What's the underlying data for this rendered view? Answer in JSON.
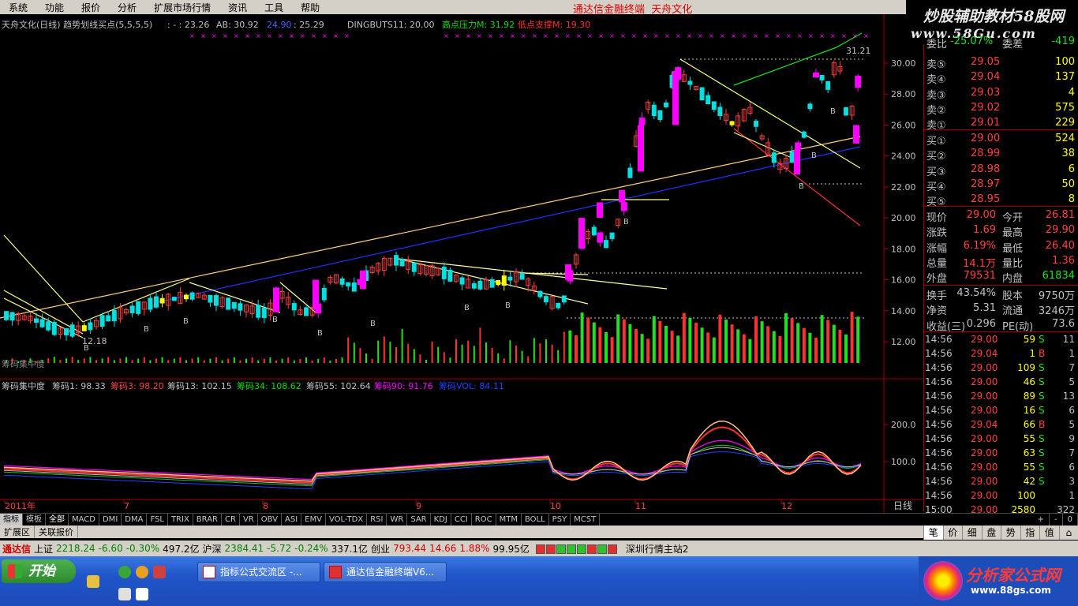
{
  "menu": {
    "items": [
      "系统",
      "功能",
      "报价",
      "分析",
      "扩展市场行情",
      "资讯",
      "工具",
      "帮助"
    ],
    "app_title": "通达信金融终端",
    "stock_name_top": "天舟文化"
  },
  "logo": {
    "line1": "炒股辅助教材58股网",
    "line2": "www.58Gu.com"
  },
  "main_header": {
    "title": "天舟文化(日线) 趋势划线买点(5,5,5,5)",
    "field1": ": - : 23.26",
    "field2": "AB: 30.92",
    "field3": "24.90",
    "field4": ": 25.29",
    "field5": "DINGBUTS11: 20.00",
    "field6": "高点压力M: 31.92",
    "field7": "低点支撑M: 19.30"
  },
  "y_labels_main": [
    "30.00",
    "28.00",
    "26.00",
    "24.00",
    "22.00",
    "20.00",
    "18.00",
    "16.00",
    "14.00",
    "12.00"
  ],
  "annotations": {
    "high_label": "31.21",
    "low_label": "12.18",
    "vol_label": "筹码集中度",
    "b_marks": [
      "B",
      "B",
      "B",
      "B",
      "B",
      "B",
      "B",
      "B",
      "B",
      "B",
      "B",
      "B"
    ]
  },
  "sub_header": {
    "title": "筹码集中度",
    "f1": "筹码1: 98.33",
    "f2": "筹码3: 98.20",
    "f3": "筹码13: 102.15",
    "f4": "筹码34: 108.62",
    "f5": "筹码55: 102.64",
    "f6": "筹码90: 91.76",
    "f7": "筹码VOL: 84.11"
  },
  "y_labels_sub": [
    "200.0",
    "100.0"
  ],
  "x_labels": [
    "2011年",
    "7",
    "8",
    "9",
    "10",
    "11",
    "12"
  ],
  "xaxis_right": "日线",
  "toolbar": {
    "tabs": [
      "指标",
      "模板",
      "全部",
      "MACD",
      "DMI",
      "DMA",
      "FSL",
      "TRIX",
      "BRAR",
      "CR",
      "VR",
      "OBV",
      "ASI",
      "EMV",
      "VOL-TDX",
      "RSI",
      "WR",
      "SAR",
      "KDJ",
      "CCI",
      "ROC",
      "MTM",
      "BOLL",
      "PSY",
      "MCST"
    ],
    "right": [
      "+",
      "-",
      "0"
    ]
  },
  "subbar": {
    "items": [
      "扩展区",
      "关联报价"
    ]
  },
  "side_tabs": [
    "笔",
    "价",
    "细",
    "盘",
    "势",
    "指",
    "值",
    "⌂"
  ],
  "quote": {
    "top_cut": {
      "l1": "委比",
      "v1": "-25.07%",
      "l2": "委差",
      "v2": "-419"
    },
    "sell": [
      {
        "label": "卖⑤",
        "price": "29.05",
        "vol": "100"
      },
      {
        "label": "卖④",
        "price": "29.04",
        "vol": "137"
      },
      {
        "label": "卖③",
        "price": "29.03",
        "vol": "4"
      },
      {
        "label": "卖②",
        "price": "29.02",
        "vol": "575"
      },
      {
        "label": "卖①",
        "price": "29.01",
        "vol": "229"
      }
    ],
    "buy": [
      {
        "label": "买①",
        "price": "29.00",
        "vol": "524"
      },
      {
        "label": "买②",
        "price": "28.99",
        "vol": "38"
      },
      {
        "label": "买③",
        "price": "28.98",
        "vol": "6"
      },
      {
        "label": "买④",
        "price": "28.97",
        "vol": "50"
      },
      {
        "label": "买⑤",
        "price": "28.95",
        "vol": "8"
      }
    ],
    "stats": [
      {
        "l1": "现价",
        "v1": "29.00",
        "l2": "今开",
        "v2": "26.81"
      },
      {
        "l1": "涨跌",
        "v1": "1.69",
        "l2": "最高",
        "v2": "29.90"
      },
      {
        "l1": "涨幅",
        "v1": "6.19%",
        "l2": "最低",
        "v2": "26.40"
      },
      {
        "l1": "总量",
        "v1": "14.1万",
        "l2": "量比",
        "v2": "1.36"
      },
      {
        "l1": "外盘",
        "v1": "79531",
        "l2": "内盘",
        "v2": "61834"
      }
    ],
    "stats2": [
      {
        "l1": "换手",
        "v1": "43.54%",
        "l2": "股本",
        "v2": "9750万"
      },
      {
        "l1": "净资",
        "v1": "5.31",
        "l2": "流通",
        "v2": "3246万"
      },
      {
        "l1": "收益(三)",
        "v1": "0.296",
        "l2": "PE(动)",
        "v2": "73.6"
      }
    ],
    "ticks": [
      {
        "t": "14:56",
        "p": "29.00",
        "v": "59",
        "s": "S",
        "n": "11"
      },
      {
        "t": "14:56",
        "p": "29.04",
        "v": "1",
        "s": "B",
        "n": "1"
      },
      {
        "t": "14:56",
        "p": "29.00",
        "v": "109",
        "s": "S",
        "n": "7"
      },
      {
        "t": "14:56",
        "p": "29.00",
        "v": "46",
        "s": "S",
        "n": "5"
      },
      {
        "t": "14:56",
        "p": "29.00",
        "v": "89",
        "s": "S",
        "n": "13"
      },
      {
        "t": "14:56",
        "p": "29.00",
        "v": "16",
        "s": "S",
        "n": "6"
      },
      {
        "t": "14:56",
        "p": "29.04",
        "v": "66",
        "s": "B",
        "n": "5"
      },
      {
        "t": "14:56",
        "p": "29.00",
        "v": "55",
        "s": "S",
        "n": "9"
      },
      {
        "t": "14:56",
        "p": "29.00",
        "v": "63",
        "s": "S",
        "n": "7"
      },
      {
        "t": "14:56",
        "p": "29.00",
        "v": "55",
        "s": "S",
        "n": "6"
      },
      {
        "t": "14:56",
        "p": "29.00",
        "v": "42",
        "s": "S",
        "n": "3"
      },
      {
        "t": "14:56",
        "p": "29.00",
        "v": "100",
        "s": "",
        "n": "1"
      },
      {
        "t": "15:00",
        "p": "29.00",
        "v": "2580",
        "s": "",
        "n": "322"
      }
    ]
  },
  "status": {
    "brand": "通达信",
    "sh_label": "上证",
    "sh_val": "2218.24",
    "sh_chg": "-6.60",
    "sh_pct": "-0.30%",
    "sh_amt": "497.2亿",
    "sz_label": "沪深",
    "sz_val": "2384.41",
    "sz_chg": "-5.72",
    "sz_pct": "-0.24%",
    "sz_amt": "337.1亿",
    "cy_label": "创业",
    "cy_val": "793.44",
    "cy_chg": "14.66",
    "cy_pct": "1.88%",
    "cy_amt": "99.95亿",
    "server": "深圳行情主站2"
  },
  "taskbar": {
    "start": "开始",
    "tasks": [
      "指标公式交流区 -...",
      "通达信金融终端V6..."
    ]
  },
  "brand88": {
    "name": "分析家公式网",
    "url": "www.88gs.com"
  },
  "colors": {
    "up": "#ff3c3c",
    "down": "#00e0e0",
    "magenta": "#ff00ff",
    "yellow": "#ffff00",
    "green": "#00d000",
    "label": "#c0c0c0"
  }
}
